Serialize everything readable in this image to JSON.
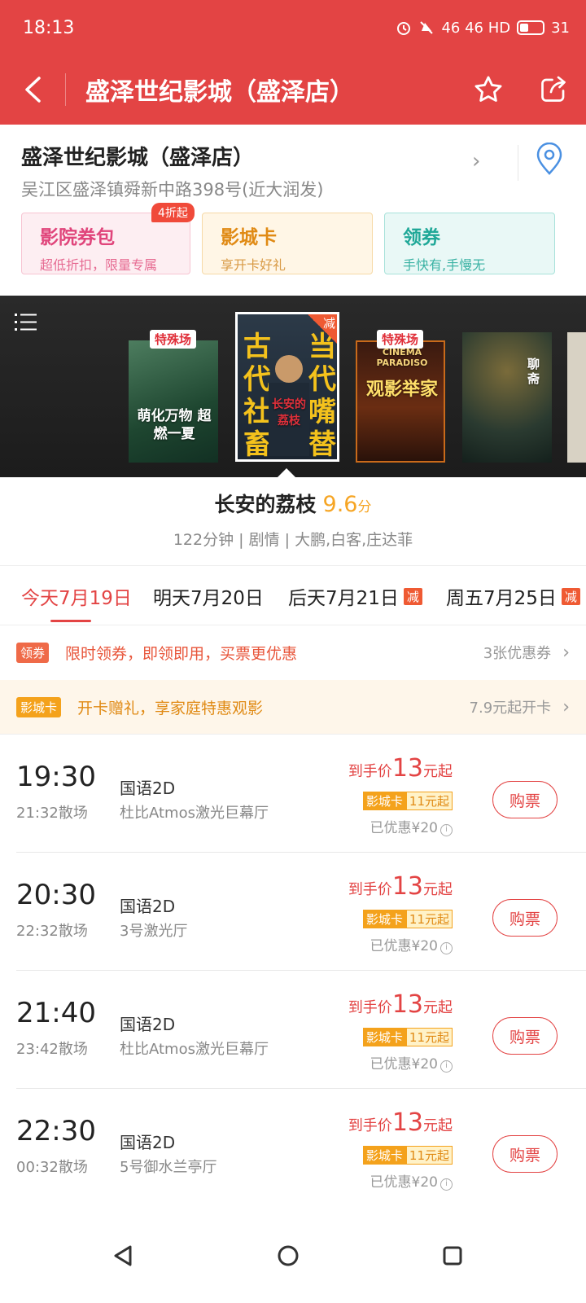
{
  "status": {
    "time": "18:13",
    "network": "46 46 HD",
    "battery": "31"
  },
  "header": {
    "title": "盛泽世纪影城（盛泽店）"
  },
  "cinema": {
    "name": "盛泽世纪影城（盛泽店）",
    "address": "吴江区盛泽镇舜新中路398号(近大润发)",
    "cards": [
      {
        "title": "影院券包",
        "sub": "超低折扣，限量专属",
        "badge": "4折起"
      },
      {
        "title": "影城卡",
        "sub": "享开卡好礼"
      },
      {
        "title": "领券",
        "sub": "手快有,手慢无"
      }
    ]
  },
  "posters": {
    "special_tag": "特殊场",
    "reduce_tag": "减",
    "p1_text": "萌化万物 超燃一夏",
    "p2_left": "古代社畜",
    "p2_right": "当代嘴替",
    "p2_title": "长安的荔枝",
    "p3_top": "CINEMA PARADISO",
    "p3_text": "观影举家",
    "p4_text": "聊斋"
  },
  "movie": {
    "name": "长安的荔枝",
    "score": "9.6",
    "score_unit": "分",
    "meta": "122分钟 | 剧情 | 大鹏,白客,庄达菲"
  },
  "dates": [
    {
      "label": "今天7月19日",
      "active": true
    },
    {
      "label": "明天7月20日"
    },
    {
      "label": "后天7月21日",
      "tag": "减"
    },
    {
      "label": "周五7月25日",
      "tag": "减"
    }
  ],
  "promos": {
    "coupon": {
      "tag": "领券",
      "text": "限时领券，即领即用，买票更优惠",
      "right": "3张优惠券"
    },
    "card": {
      "tag": "影城卡",
      "text": "开卡赠礼，享家庭特惠观影",
      "right": "7.9元起开卡"
    }
  },
  "showtimes": [
    {
      "start": "19:30",
      "end": "21:32散场",
      "lang": "国语2D",
      "hall": "杜比Atmos激光巨幕厅",
      "price_prefix": "到手价",
      "price": "13",
      "price_suffix": "元起",
      "card_label": "影城卡",
      "card_price": "11元起",
      "discount": "已优惠¥20",
      "buy": "购票"
    },
    {
      "start": "20:30",
      "end": "22:32散场",
      "lang": "国语2D",
      "hall": "3号激光厅",
      "price_prefix": "到手价",
      "price": "13",
      "price_suffix": "元起",
      "card_label": "影城卡",
      "card_price": "11元起",
      "discount": "已优惠¥20",
      "buy": "购票"
    },
    {
      "start": "21:40",
      "end": "23:42散场",
      "lang": "国语2D",
      "hall": "杜比Atmos激光巨幕厅",
      "price_prefix": "到手价",
      "price": "13",
      "price_suffix": "元起",
      "card_label": "影城卡",
      "card_price": "11元起",
      "discount": "已优惠¥20",
      "buy": "购票"
    },
    {
      "start": "22:30",
      "end": "00:32散场",
      "lang": "国语2D",
      "hall": "5号御水兰亭厅",
      "price_prefix": "到手价",
      "price": "13",
      "price_suffix": "元起",
      "card_label": "影城卡",
      "card_price": "11元起",
      "discount": "已优惠¥20",
      "buy": "购票"
    }
  ],
  "colors": {
    "brand": "#e34444",
    "score": "#f6a524",
    "card": "#f4a21c"
  }
}
